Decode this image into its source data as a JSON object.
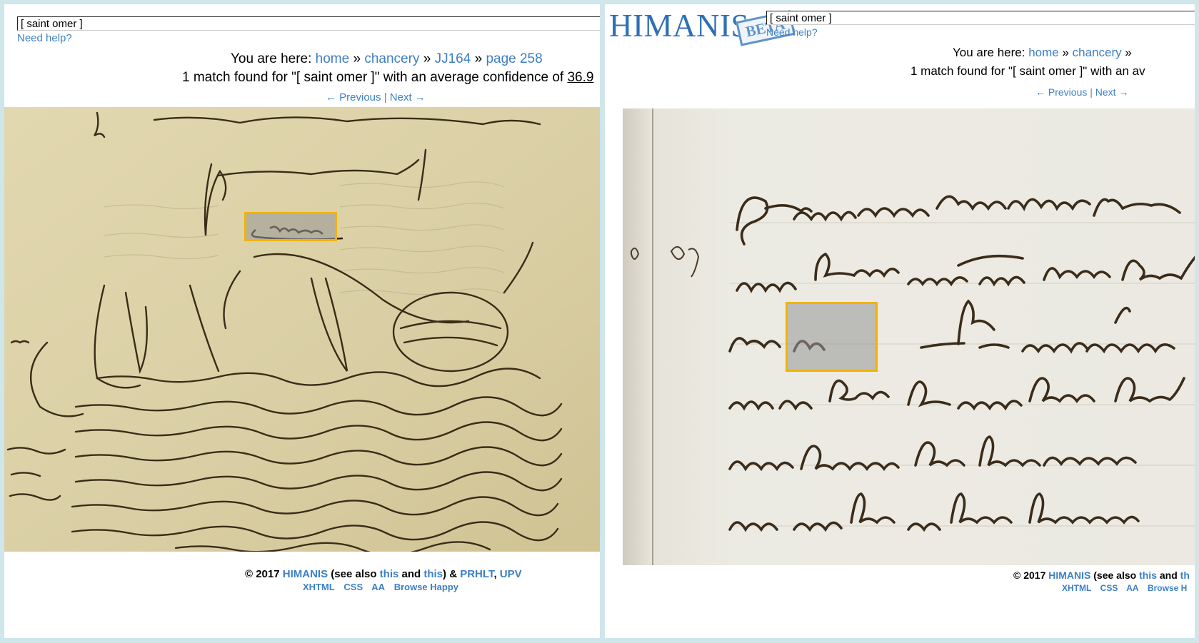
{
  "left": {
    "search": {
      "value": "[ saint omer ]"
    },
    "help_label": "Need help?",
    "breadcrumb": {
      "prefix": "You are here:",
      "items": [
        "home",
        "chancery",
        "JJ164",
        "page 258"
      ],
      "separator": "»"
    },
    "match": {
      "text": "1 match found for \"[ saint omer ]\" with an average confidence of ",
      "confidence": "36.9"
    },
    "pager": {
      "previous": "← Previous",
      "divider": "|",
      "next": "Next →"
    },
    "footer": {
      "copyright": "© 2017",
      "org": "HIMANIS",
      "see_also": "(see also",
      "this1": "this",
      "and": "and",
      "this2": "this",
      "close_amp": ") &",
      "prhlt": "PRHLT",
      "comma": ",",
      "upv": "UPV"
    },
    "footer_links": [
      "XHTML",
      "CSS",
      "AA",
      "Browse Happy"
    ]
  },
  "right": {
    "logo": "HIMANIS",
    "beta": "BETA",
    "search": {
      "value": "[ saint omer ]"
    },
    "help_label": "Need help?",
    "breadcrumb": {
      "prefix": "You are here:",
      "items": [
        "home",
        "chancery"
      ],
      "separator": "»"
    },
    "match": {
      "text": "1 match found for \"[ saint omer ]\" with an av"
    },
    "pager": {
      "previous": "← Previous",
      "divider": "|",
      "next": "Next →"
    },
    "footer": {
      "copyright": "© 2017",
      "org": "HIMANIS",
      "see_also": "(see also",
      "this1": "this",
      "and": "and",
      "this2": "th"
    },
    "footer_links": [
      "XHTML",
      "CSS",
      "AA",
      "Browse H"
    ]
  },
  "colors": {
    "link": "#3d7fc4",
    "highlight_border": "#f1b300",
    "background": "#cfe6ea",
    "parchment_left": "#ddd3a9",
    "parchment_right": "#ebe9e0",
    "ink": "#3a2c18"
  }
}
